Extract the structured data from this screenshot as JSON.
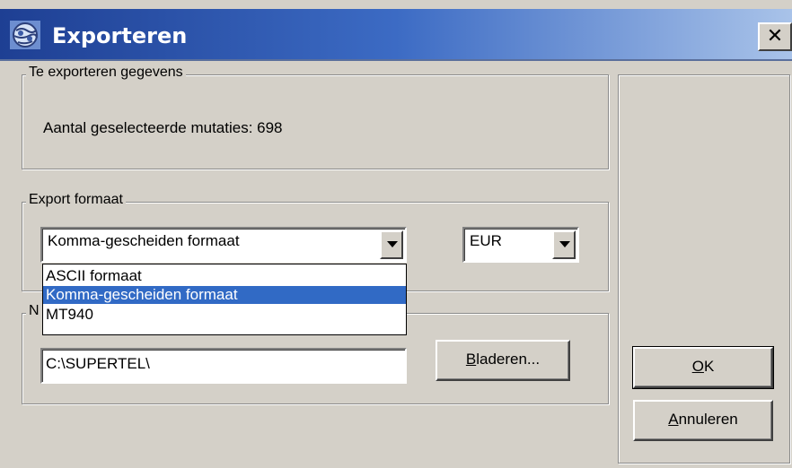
{
  "window": {
    "title": "Exporteren",
    "close_label": "✕"
  },
  "data_group": {
    "legend": "Te exporteren gegevens",
    "count_text": "Aantal geselecteerde mutaties: 698"
  },
  "format_group": {
    "legend": "Export formaat",
    "format_select": {
      "value": "Komma-gescheiden formaat"
    },
    "currency_select": {
      "value": "EUR"
    },
    "format_options": [
      {
        "label": "ASCII formaat",
        "selected": false
      },
      {
        "label": "Komma-gescheiden formaat",
        "selected": true
      },
      {
        "label": "MT940",
        "selected": false
      }
    ]
  },
  "path_group": {
    "legend_visible": "N",
    "path_value": "C:\\SUPERTEL\\",
    "browse_label_mnemonic": "B",
    "browse_label_rest": "laderen..."
  },
  "buttons": {
    "ok_mnemonic": "O",
    "ok_rest": "K",
    "cancel_mnemonic": "A",
    "cancel_rest": "nnuleren"
  },
  "colors": {
    "titlebar_start": "#1e3f93",
    "titlebar_end": "#a9c3e9",
    "selection": "#316ac5",
    "face": "#d4d0c8"
  }
}
